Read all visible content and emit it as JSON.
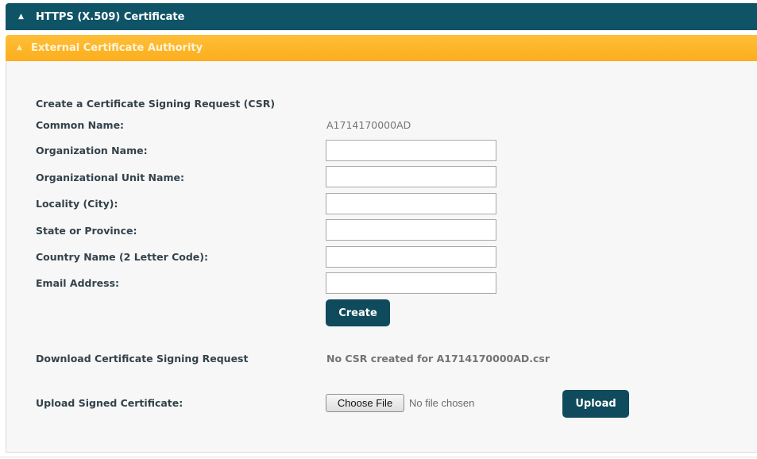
{
  "header": {
    "title": "HTTPS (X.509) Certificate",
    "chevron_icon": "chevron-up-icon"
  },
  "section": {
    "title": "External Certificate Authority",
    "chevron_icon": "chevron-up-icon"
  },
  "form": {
    "heading": "Create a Certificate Signing Request (CSR)",
    "common_name_label": "Common Name:",
    "common_name_value": "A1714170000AD",
    "fields": [
      {
        "label": "Organization Name:",
        "value": ""
      },
      {
        "label": "Organizational Unit Name:",
        "value": ""
      },
      {
        "label": "Locality (City):",
        "value": ""
      },
      {
        "label": "State or Province:",
        "value": ""
      },
      {
        "label": "Country Name (2 Letter Code):",
        "value": ""
      },
      {
        "label": "Email Address:",
        "value": ""
      }
    ],
    "create_label": "Create"
  },
  "download": {
    "label": "Download Certificate Signing Request",
    "status": "No CSR created for A1714170000AD.csr"
  },
  "upload": {
    "label": "Upload Signed Certificate:",
    "choose_label": "Choose File",
    "file_status": "No file chosen",
    "upload_label": "Upload"
  },
  "colors": {
    "header_bg": "#0f5366",
    "section_bg": "#fdb527",
    "button_bg": "#0f4b5c",
    "panel_bg": "#f7f7f7"
  }
}
